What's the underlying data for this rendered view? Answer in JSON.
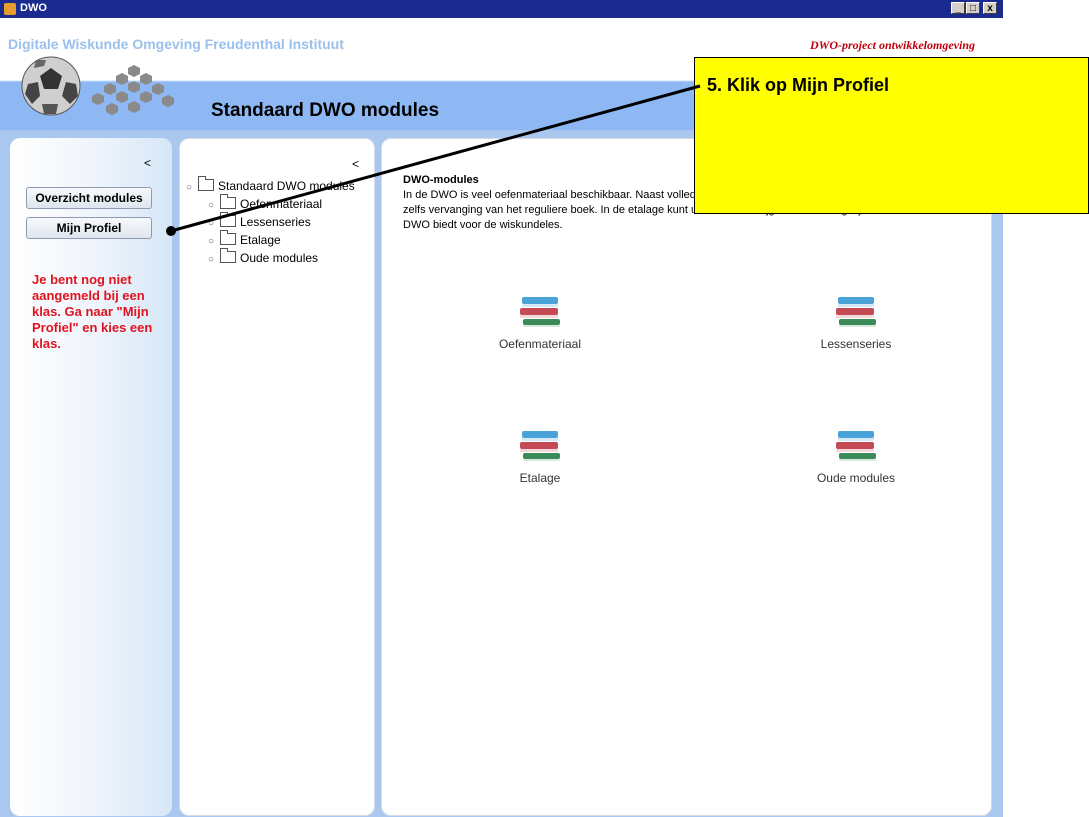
{
  "window": {
    "title": "DWO",
    "controls": {
      "minimize": "_",
      "maximize": "□",
      "close": "x"
    }
  },
  "header": {
    "brand": "Digitale Wiskunde Omgeving  Freudenthal Instituut",
    "project": "DWO-project ontwikkelomgeving",
    "module_title": "Standaard DWO modules"
  },
  "left_panel": {
    "collapse": "<",
    "buttons": [
      "Overzicht modules",
      "Mijn Profiel"
    ],
    "warning": "Je bent nog niet aangemeld bij een klas. Ga naar \"Mijn Profiel\" en kies een klas."
  },
  "tree_panel": {
    "collapse": "<",
    "root": "Standaard DWO modules",
    "children": [
      "Oefenmateriaal",
      "Lessenseries",
      "Etalage",
      "Oude modules"
    ]
  },
  "main": {
    "intro_title": "DWO-modules",
    "intro_text": "In de DWO is veel oefenmateriaal beschikbaar. Naast volledige lessen en lessenseries beschikbaar, die zelfs vervanging van het reguliere boek. In de etalage kunt u een indruk krijgen van de mogelijkheden die de DWO biedt voor de wiskundeles.",
    "modules": [
      "Oefenmateriaal",
      "Lessenseries",
      "Etalage",
      "Oude modules"
    ],
    "module_icon": "books-icon"
  },
  "callout": {
    "text": "5. Klik op Mijn Profiel"
  },
  "colors": {
    "titlebar": "#1b2a8f",
    "header_band": "#8eb8f4",
    "brand": "#9ac0ec",
    "project": "#c0000e",
    "warning": "#e0141e",
    "callout": "#ffff00"
  }
}
